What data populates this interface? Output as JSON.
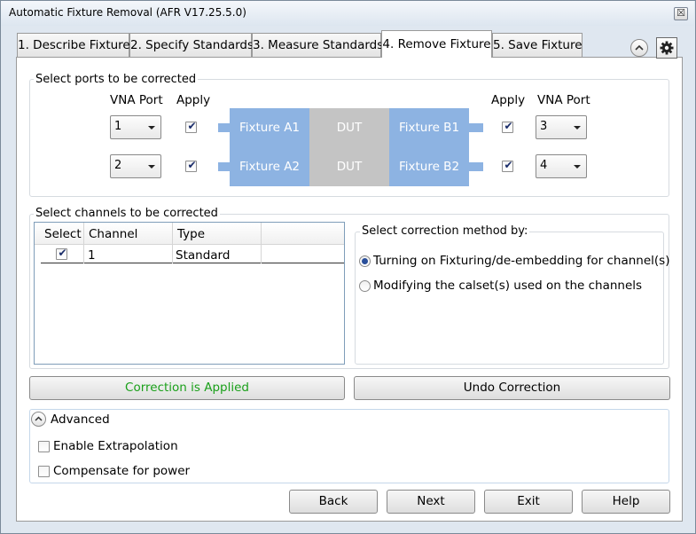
{
  "window": {
    "title": "Automatic Fixture Removal (AFR V17.25.5.0)",
    "close_glyph": "☒"
  },
  "tabs": [
    {
      "label": "1. Describe Fixture"
    },
    {
      "label": "2. Specify Standards"
    },
    {
      "label": "3. Measure Standards"
    },
    {
      "label": "4. Remove Fixture"
    },
    {
      "label": "5. Save Fixture"
    }
  ],
  "active_tab": "4. Remove Fixture",
  "toolbar": {
    "collapse_icon": "chevron-up-icon",
    "settings_icon": "gear-icon"
  },
  "ports": {
    "group_label": "Select ports to be corrected",
    "left_vna_header": "VNA Port",
    "left_apply_header": "Apply",
    "right_apply_header": "Apply",
    "right_vna_header": "VNA Port",
    "rows": [
      {
        "left_port": "1",
        "left_apply": true,
        "fixture_left": "Fixture A1",
        "dut": "DUT",
        "fixture_right": "Fixture B1",
        "right_apply": true,
        "right_port": "3"
      },
      {
        "left_port": "2",
        "left_apply": true,
        "fixture_left": "Fixture A2",
        "dut": "DUT",
        "fixture_right": "Fixture B2",
        "right_apply": true,
        "right_port": "4"
      }
    ],
    "colors": {
      "fixture": "#8db3e2",
      "dut": "#c4c4c4"
    }
  },
  "channels": {
    "group_label": "Select channels to be corrected",
    "columns": [
      "Select",
      "Channel",
      "Type"
    ],
    "rows": [
      {
        "selected": true,
        "channel": "1",
        "type": "Standard"
      }
    ]
  },
  "method": {
    "group_label": "Select correction method by:",
    "options": [
      {
        "label": "Turning on Fixturing/de-embedding  for channel(s)",
        "selected": true
      },
      {
        "label": "Modifying the calset(s) used on the channels",
        "selected": false
      }
    ]
  },
  "actions": {
    "status_label": "Correction is Applied",
    "status_color": "#1aa01a",
    "undo_label": "Undo Correction"
  },
  "advanced": {
    "label": "Advanced",
    "options": [
      {
        "label": "Enable Extrapolation",
        "checked": false
      },
      {
        "label": "Compensate for power",
        "checked": false
      }
    ]
  },
  "footer": {
    "back_label": "Back",
    "next_label": "Next",
    "exit_label": "Exit",
    "help_label": "Help"
  }
}
